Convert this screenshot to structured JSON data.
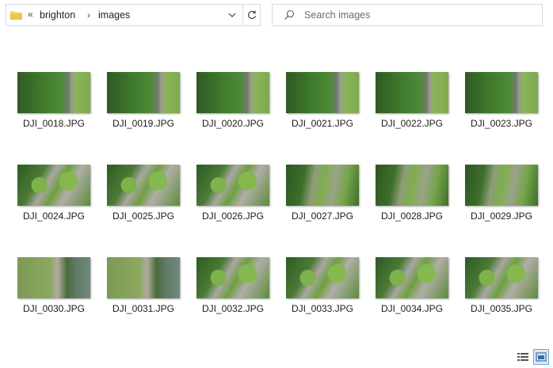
{
  "address": {
    "overflow": "«",
    "crumbs": [
      "brighton",
      "images"
    ],
    "separator": "›"
  },
  "search": {
    "placeholder": "Search images"
  },
  "files": [
    {
      "name": "DJI_0018.JPG",
      "palette": "trees-path"
    },
    {
      "name": "DJI_0019.JPG",
      "palette": "trees-path"
    },
    {
      "name": "DJI_0020.JPG",
      "palette": "trees-path"
    },
    {
      "name": "DJI_0021.JPG",
      "palette": "trees-path"
    },
    {
      "name": "DJI_0022.JPG",
      "palette": "trees-path"
    },
    {
      "name": "DJI_0023.JPG",
      "palette": "trees-path"
    },
    {
      "name": "DJI_0024.JPG",
      "palette": "park-paths"
    },
    {
      "name": "DJI_0025.JPG",
      "palette": "park-paths"
    },
    {
      "name": "DJI_0026.JPG",
      "palette": "park-paths"
    },
    {
      "name": "DJI_0027.JPG",
      "palette": "park-lawn"
    },
    {
      "name": "DJI_0028.JPG",
      "palette": "park-lawn"
    },
    {
      "name": "DJI_0029.JPG",
      "palette": "park-lawn"
    },
    {
      "name": "DJI_0030.JPG",
      "palette": "lawn-water"
    },
    {
      "name": "DJI_0031.JPG",
      "palette": "lawn-water"
    },
    {
      "name": "DJI_0032.JPG",
      "palette": "park-paths"
    },
    {
      "name": "DJI_0033.JPG",
      "palette": "park-paths"
    },
    {
      "name": "DJI_0034.JPG",
      "palette": "park-paths"
    },
    {
      "name": "DJI_0035.JPG",
      "palette": "park-paths"
    }
  ],
  "view_buttons": [
    {
      "icon": "details-view-icon",
      "active": false
    },
    {
      "icon": "large-icons-view-icon",
      "active": true
    }
  ]
}
